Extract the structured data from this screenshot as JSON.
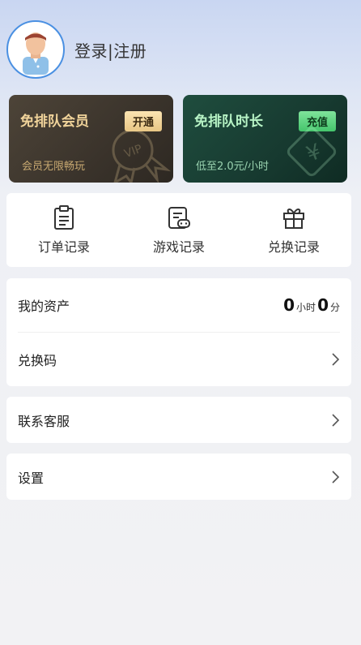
{
  "header": {
    "login_label": "登录|注册"
  },
  "cards": {
    "vip": {
      "title": "免排队会员",
      "button": "开通",
      "subtitle": "会员无限畅玩",
      "deco_text": "VIP"
    },
    "time": {
      "title": "免排队时长",
      "button": "充值",
      "subtitle": "低至2.0元/小时",
      "deco_text": "¥"
    }
  },
  "quick_actions": [
    {
      "label": "订单记录",
      "icon": "clipboard-icon"
    },
    {
      "label": "游戏记录",
      "icon": "game-record-icon"
    },
    {
      "label": "兑换记录",
      "icon": "gift-icon"
    }
  ],
  "assets": {
    "label": "我的资产",
    "hours_value": "0",
    "hours_unit": "小时",
    "minutes_value": "0",
    "minutes_unit": "分",
    "redeem_label": "兑换码"
  },
  "service": {
    "label": "联系客服"
  },
  "settings": {
    "label": "设置"
  },
  "colors": {
    "accent_border": "#4a90e2",
    "vip_pill": "#f0d39a",
    "time_pill": "#45c56c"
  }
}
